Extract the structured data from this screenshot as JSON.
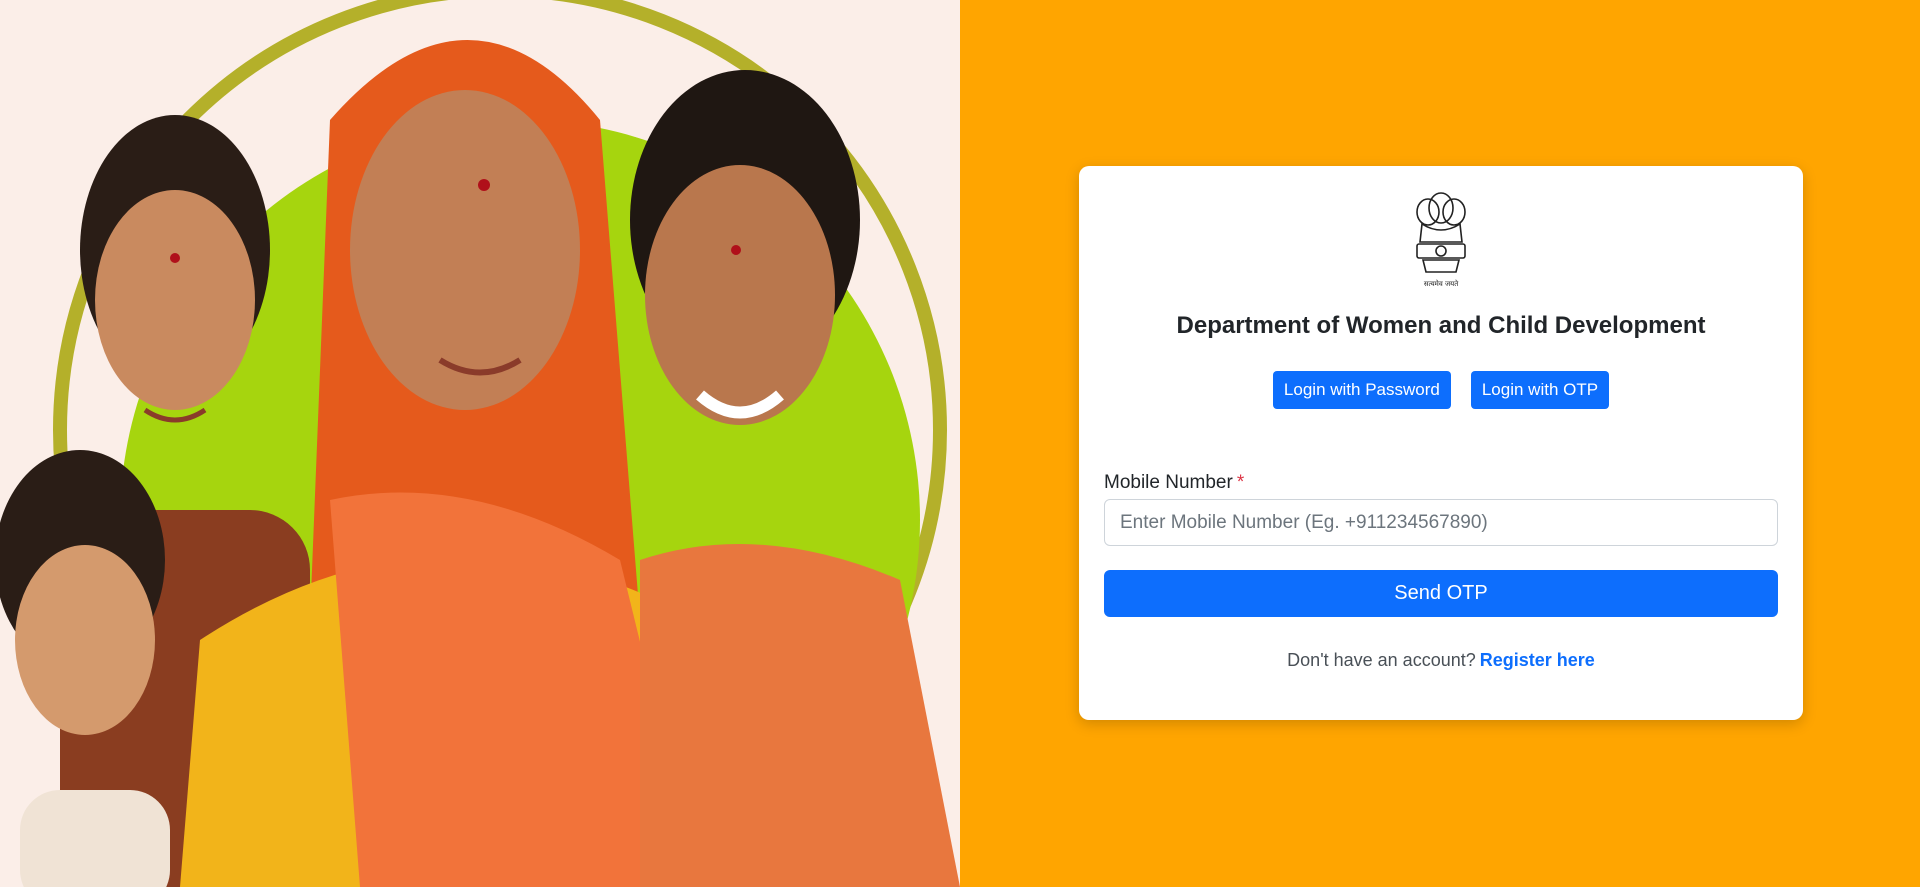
{
  "hero": {
    "image_name": "women-and-children-photo",
    "colors": {
      "background": "#fbeee8",
      "green_circle": "#a6d50e",
      "saree_orange": "#f2733a",
      "yellow": "#f2b41a"
    }
  },
  "colors": {
    "page_background": "#ffa500",
    "primary": "#0d6efd",
    "required": "#dc3545"
  },
  "card": {
    "emblem_icon": "national-emblem-icon",
    "emblem_motto": "सत्यमेव जयते",
    "title": "Department of Women and Child Development",
    "tabs": [
      {
        "label": "Login with Password"
      },
      {
        "label": "Login with OTP"
      }
    ],
    "mobile": {
      "label": "Mobile Number",
      "required_mark": "*",
      "placeholder": "Enter Mobile Number (Eg. +911234567890)",
      "value": ""
    },
    "send_otp_label": "Send OTP",
    "register": {
      "prompt": "Don't have an account?",
      "link_label": "Register here"
    }
  }
}
